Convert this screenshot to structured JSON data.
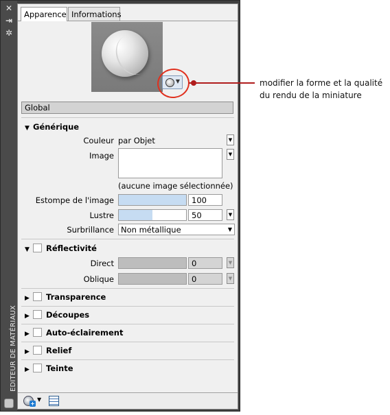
{
  "window": {
    "title": "EDITEUR DE MATÉRIAUX",
    "buttons": {
      "close": "✕",
      "autohide": "⇥",
      "properties": "✲"
    }
  },
  "tabs": [
    {
      "label": "Apparence",
      "active": true
    },
    {
      "label": "Informations",
      "active": false
    }
  ],
  "thumbnail": {
    "button_icon": "sphere-preview-icon"
  },
  "global_label": "Global",
  "sections": {
    "generique": {
      "title": "Générique",
      "expanded": true,
      "couleur": {
        "label": "Couleur",
        "value": "par Objet"
      },
      "image": {
        "label": "Image",
        "caption": "(aucune image sélectionnée)"
      },
      "estompe": {
        "label": "Estompe de l'image",
        "value": "100",
        "level": 1.0
      },
      "lustre": {
        "label": "Lustre",
        "value": "50",
        "level": 0.5
      },
      "surbrillance": {
        "label": "Surbrillance",
        "value": "Non métallique"
      }
    },
    "reflectivite": {
      "title": "Réflectivité",
      "expanded": true,
      "direct": {
        "label": "Direct",
        "value": "0"
      },
      "oblique": {
        "label": "Oblique",
        "value": "0"
      }
    },
    "transparence": {
      "title": "Transparence"
    },
    "decoupes": {
      "title": "Découpes"
    },
    "auto": {
      "title": "Auto-éclairement"
    },
    "relief": {
      "title": "Relief"
    },
    "teinte": {
      "title": "Teinte"
    }
  },
  "annotation": {
    "line1": "modifier la forme et la qualité",
    "line2": "du rendu de la miniature"
  },
  "colors": {
    "highlight_circle": "#e0301e",
    "leader": "#b01c1c",
    "slider_fill": "#c6dcf2"
  }
}
